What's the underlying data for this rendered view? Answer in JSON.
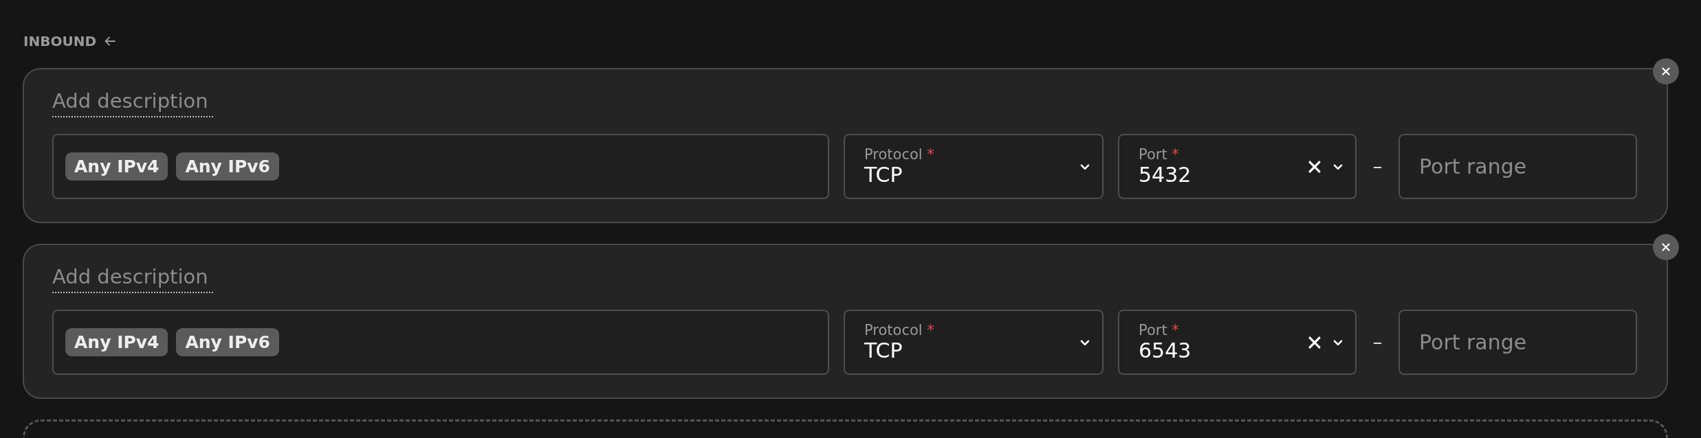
{
  "section": {
    "title": "INBOUND"
  },
  "rules": [
    {
      "description_placeholder": "Add description",
      "sources": [
        "Any IPv4",
        "Any IPv6"
      ],
      "protocol": {
        "label": "Protocol",
        "required_mark": "*",
        "value": "TCP"
      },
      "port": {
        "label": "Port",
        "required_mark": "*",
        "value": "5432"
      },
      "separator": "–",
      "port_range": {
        "placeholder": "Port range"
      }
    },
    {
      "description_placeholder": "Add description",
      "sources": [
        "Any IPv4",
        "Any IPv6"
      ],
      "protocol": {
        "label": "Protocol",
        "required_mark": "*",
        "value": "TCP"
      },
      "port": {
        "label": "Port",
        "required_mark": "*",
        "value": "6543"
      },
      "separator": "–",
      "port_range": {
        "placeholder": "Port range"
      }
    }
  ]
}
